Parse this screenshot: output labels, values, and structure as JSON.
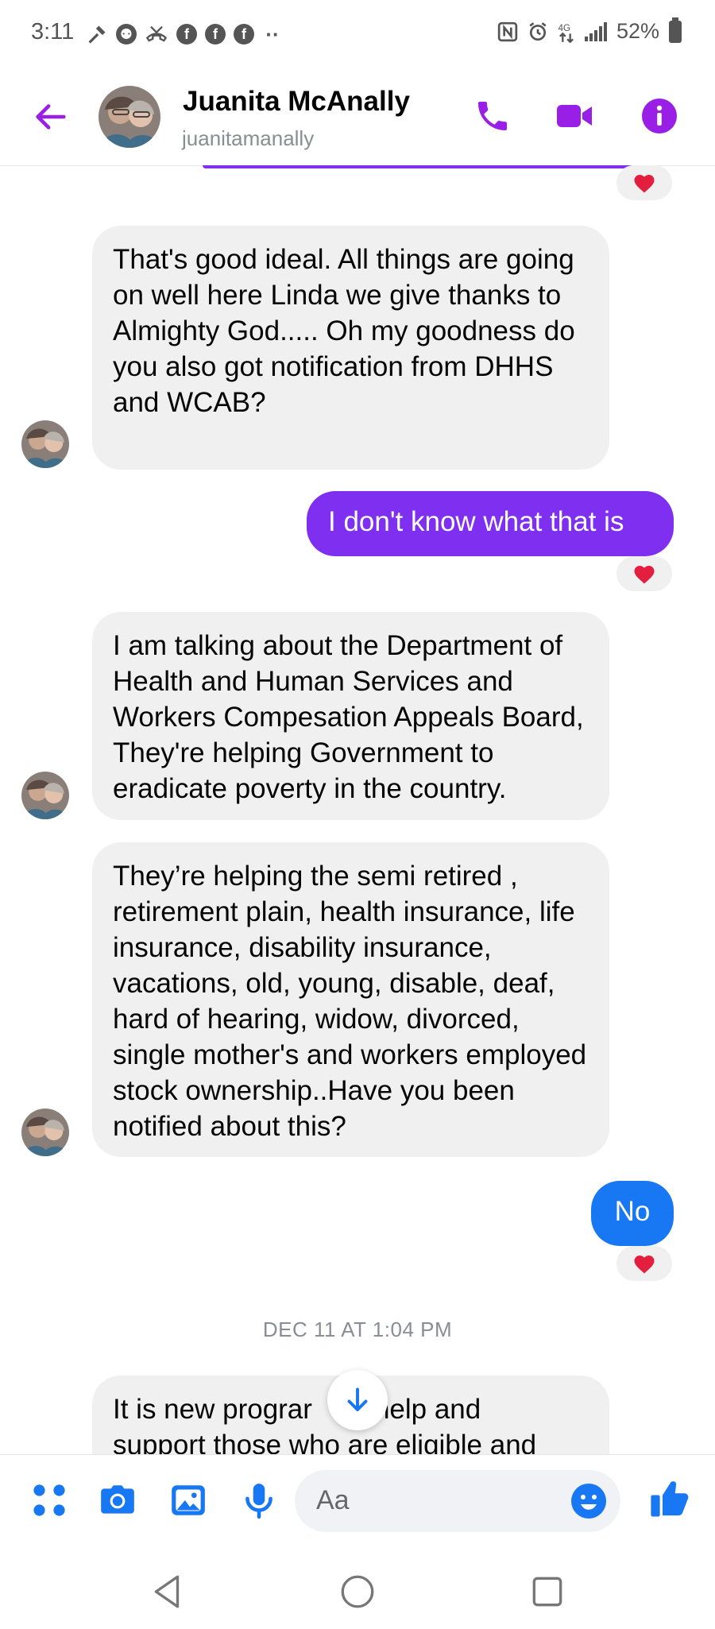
{
  "status_bar": {
    "time": "3:11",
    "battery": "52%",
    "data_label": "4G"
  },
  "header": {
    "name": "Juanita McAnally",
    "username": "juanitamanally"
  },
  "messages": [
    {
      "from": "them",
      "text": "That's good ideal. All things are going on well here Linda we give thanks to Almighty God..... Oh my goodness do you also got notification from DHHS and WCAB?"
    },
    {
      "from": "me",
      "text": "I don't know what that is",
      "reaction": "heart"
    },
    {
      "from": "them",
      "text": "I am talking about the Department of Health and Human Services and Workers Compesation Appeals Board, They're helping Government to eradicate poverty in the country."
    },
    {
      "from": "them",
      "text": "They’re helping the semi retired , retirement plain, health insurance, life insurance, disability insurance, vacations, old, young, disable, deaf, hard of hearing, widow, divorced, single mother's and workers employed stock ownership..Have you been notified about this?"
    },
    {
      "from": "me",
      "text": "No",
      "reaction": "heart"
    },
    {
      "from": "timestamp",
      "text": "DEC 11 AT 1:04 PM"
    },
    {
      "from": "them",
      "text": "It is new program to help and support those who are eligible and"
    }
  ],
  "partial_message": {
    "line1_left": "It is new prograr",
    "line1_right": "help and",
    "line2": "support those who are eligible and"
  },
  "composer": {
    "placeholder": "Aa"
  },
  "colors": {
    "accent_purple": "#7f2ff0",
    "messenger_blue": "#1877f2",
    "incoming_bubble": "#f0f0f0"
  }
}
